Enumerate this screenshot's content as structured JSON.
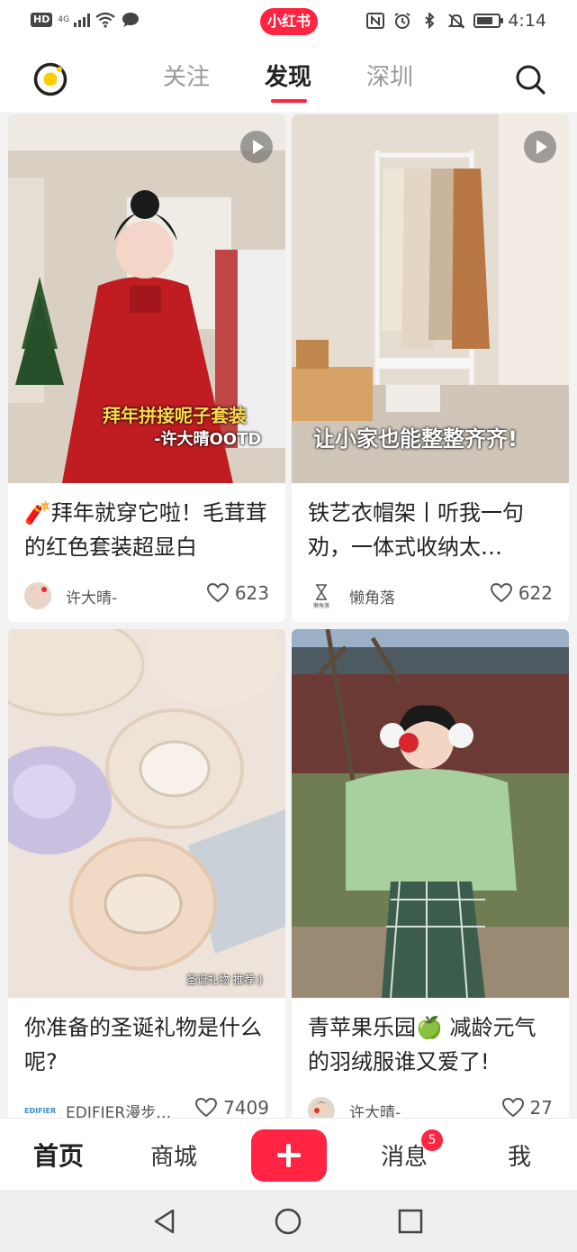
{
  "status_bar": {
    "hd": "HD",
    "network": "4G",
    "app_badge": "小红书",
    "time": "4:14",
    "battery_level": 0.75
  },
  "header": {
    "tabs": [
      {
        "label": "关注",
        "active": false
      },
      {
        "label": "发现",
        "active": true
      },
      {
        "label": "深圳",
        "active": false
      }
    ],
    "logo_icon": "camera-record-icon",
    "search_icon": "search-icon"
  },
  "feed": {
    "cards": [
      {
        "cover_caption_1": "拜年拼接呢子套装",
        "cover_caption_2": "-许大晴OOTD",
        "is_video": true,
        "title": "🧨拜年就穿它啦！毛茸茸的红色套装超显白",
        "author": "许大晴-",
        "likes": "623"
      },
      {
        "cover_caption_1": "让小家也能整整齐齐!",
        "is_video": true,
        "title": "铁艺衣帽架丨听我一句劝，一体式收纳太…",
        "author": "懒角落",
        "avatar_text": "懒角落",
        "likes": "622"
      },
      {
        "cover_caption_1": "圣诞礼物 推荐:)",
        "is_video": false,
        "title": "你准备的圣诞礼物是什么呢?",
        "author": "EDIFIER漫步…",
        "avatar_text": "EDIFIER",
        "likes": "7409"
      },
      {
        "is_video": false,
        "title": "青苹果乐园🍏 减龄元气的羽绒服谁又爱了!",
        "author": "许大晴-",
        "likes": "27"
      }
    ]
  },
  "bottom_nav": {
    "home": "首页",
    "mall": "商城",
    "messages": "消息",
    "messages_badge": "5",
    "me": "我"
  },
  "colors": {
    "brand": "#ff2442"
  }
}
